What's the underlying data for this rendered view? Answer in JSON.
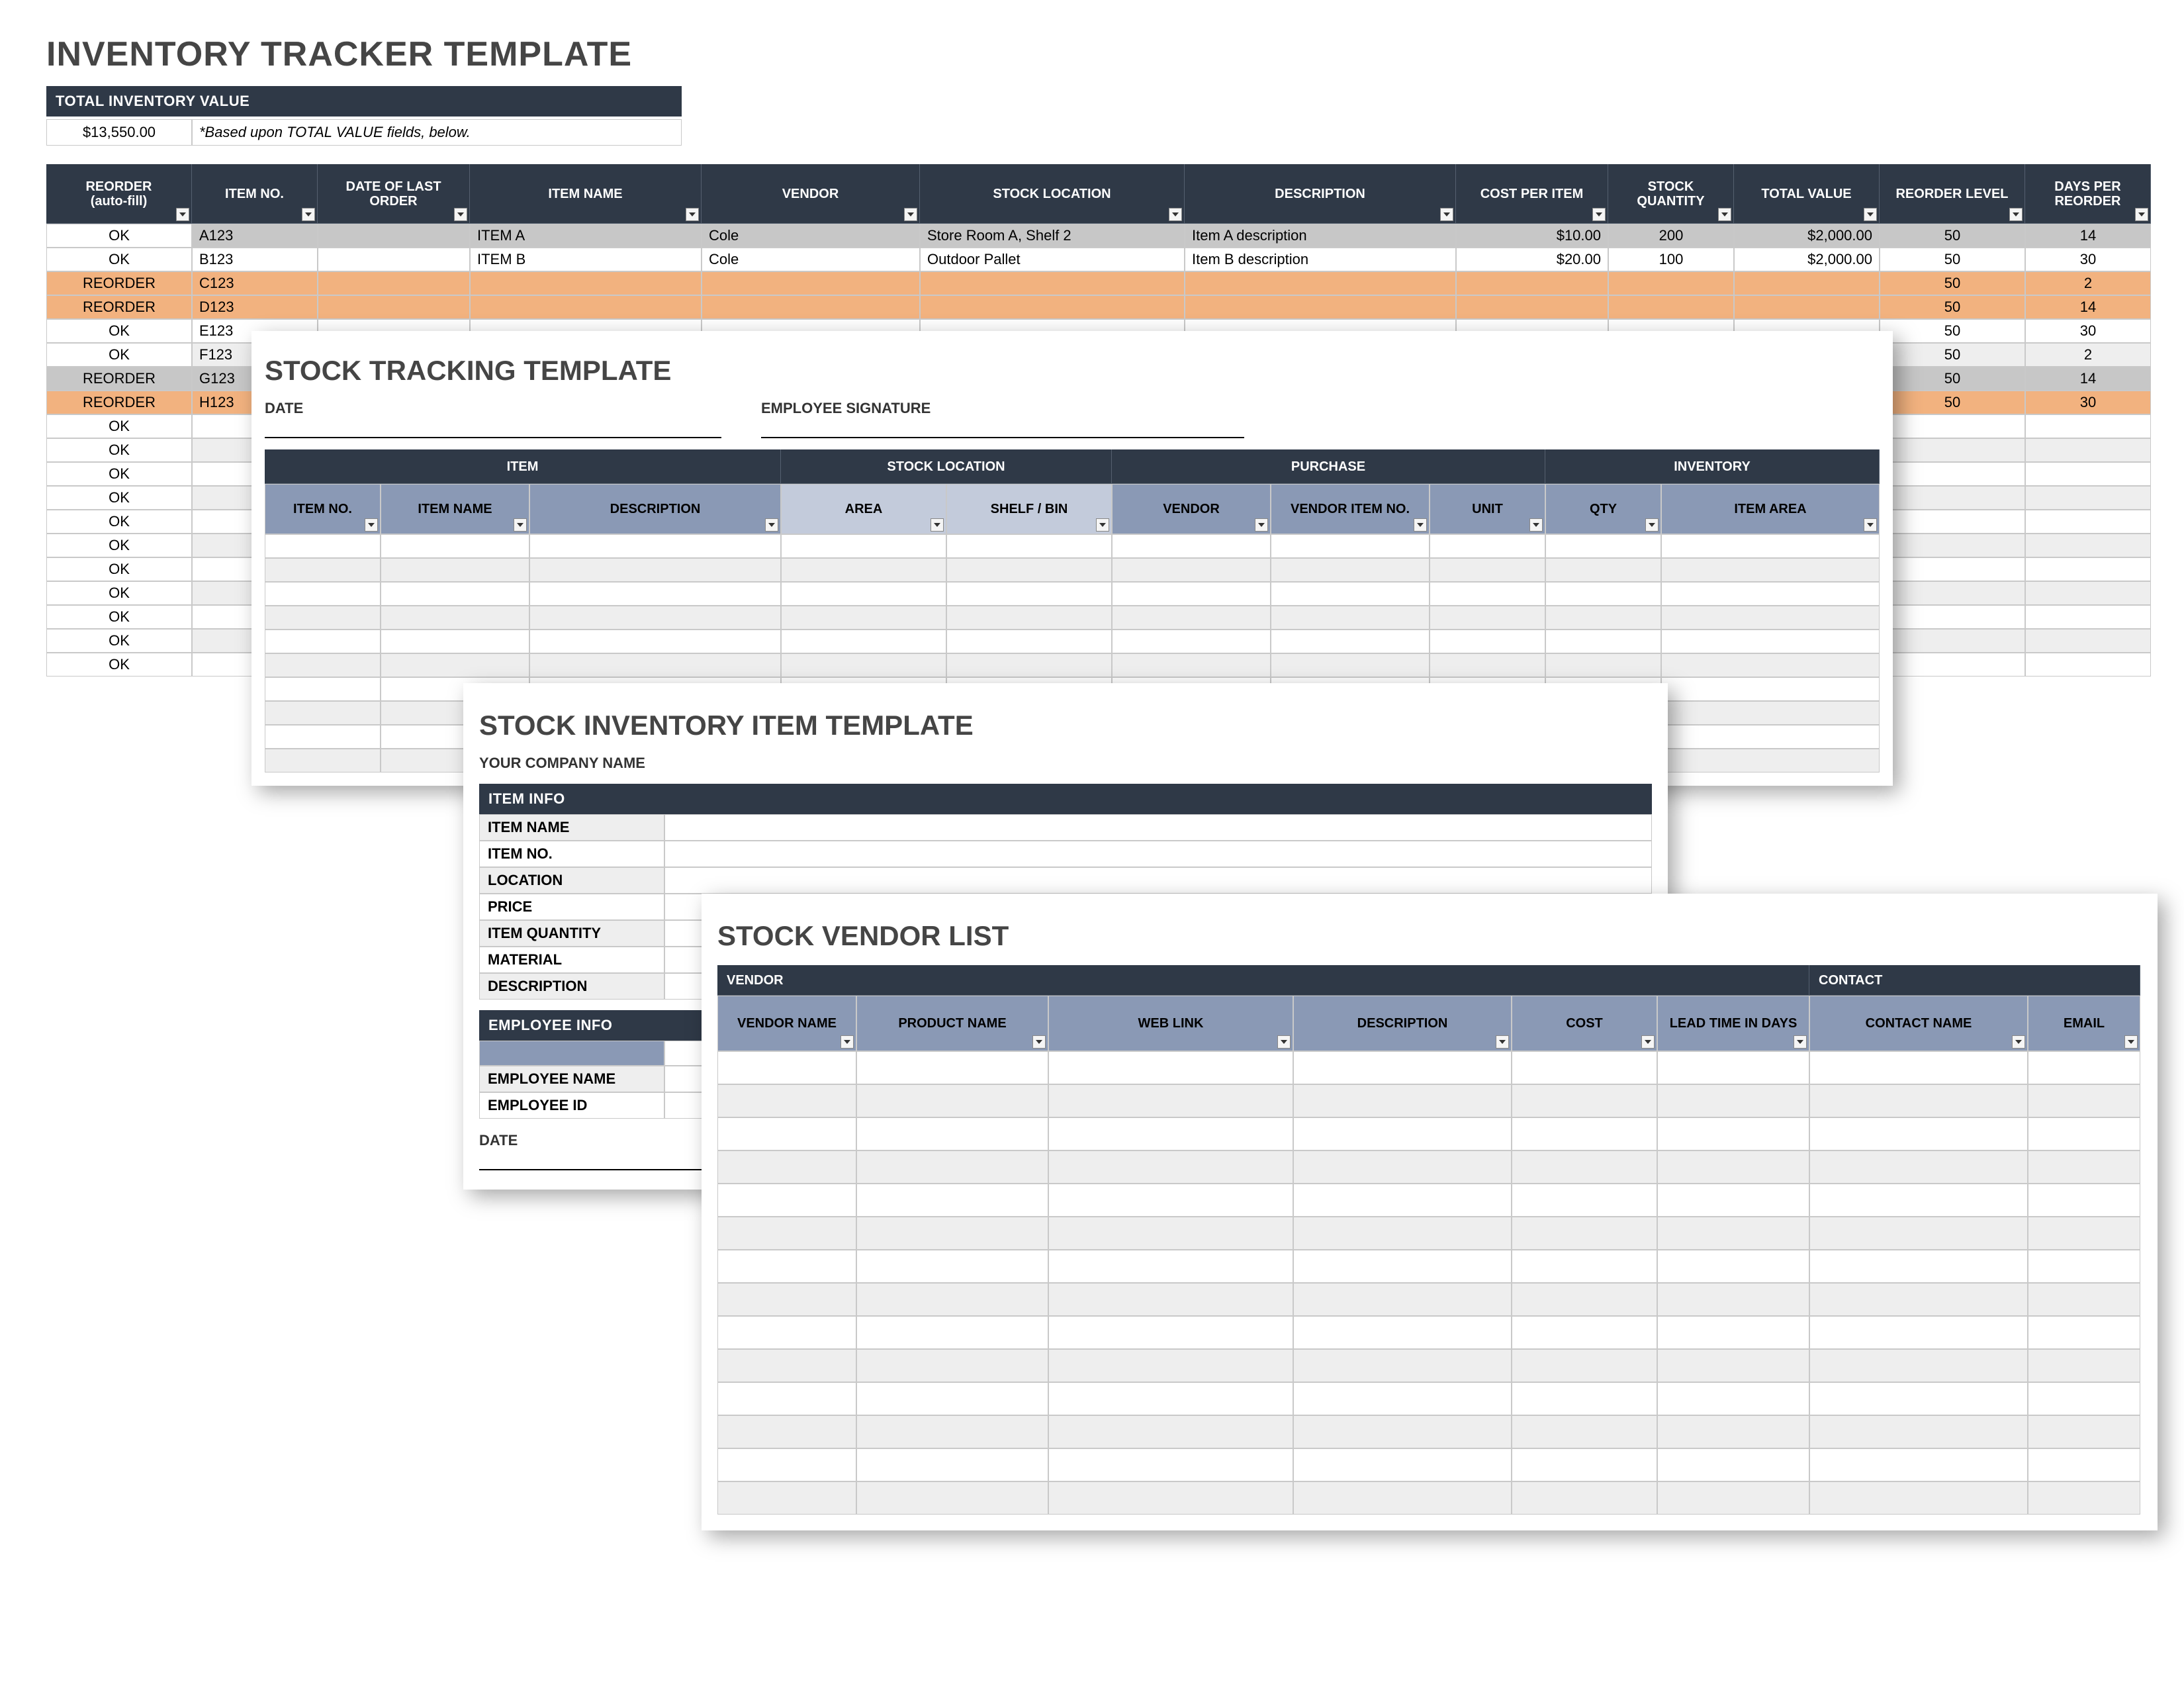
{
  "tracker": {
    "title": "INVENTORY TRACKER TEMPLATE",
    "total_label": "TOTAL INVENTORY VALUE",
    "total_value": "$13,550.00",
    "total_note": "*Based upon TOTAL VALUE fields, below.",
    "headers": [
      "REORDER\n(auto-fill)",
      "ITEM NO.",
      "DATE OF LAST ORDER",
      "ITEM NAME",
      "VENDOR",
      "STOCK LOCATION",
      "DESCRIPTION",
      "COST PER ITEM",
      "STOCK QUANTITY",
      "TOTAL VALUE",
      "REORDER LEVEL",
      "DAYS PER REORDER"
    ],
    "rows": [
      {
        "status": "OK",
        "item": "A123",
        "date": "",
        "name": "ITEM A",
        "vendor": "Cole",
        "loc": "Store Room A, Shelf 2",
        "desc": "Item A description",
        "cost": "$10.00",
        "qty": "200",
        "total": "$2,000.00",
        "reorder": "50",
        "days": "14",
        "tone": "grey"
      },
      {
        "status": "OK",
        "item": "B123",
        "date": "",
        "name": "ITEM B",
        "vendor": "Cole",
        "loc": "Outdoor Pallet",
        "desc": "Item B description",
        "cost": "$20.00",
        "qty": "100",
        "total": "$2,000.00",
        "reorder": "50",
        "days": "30",
        "tone": "even"
      },
      {
        "status": "REORDER",
        "item": "C123",
        "date": "",
        "name": "",
        "vendor": "",
        "loc": "",
        "desc": "",
        "cost": "",
        "qty": "",
        "total": "",
        "reorder": "50",
        "days": "2",
        "tone": "orange"
      },
      {
        "status": "REORDER",
        "item": "D123",
        "date": "",
        "name": "",
        "vendor": "",
        "loc": "",
        "desc": "",
        "cost": "",
        "qty": "",
        "total": "",
        "reorder": "50",
        "days": "14",
        "tone": "orange"
      },
      {
        "status": "OK",
        "item": "E123",
        "date": "",
        "name": "",
        "vendor": "",
        "loc": "",
        "desc": "",
        "cost": "",
        "qty": "",
        "total": "",
        "reorder": "50",
        "days": "30",
        "tone": "even"
      },
      {
        "status": "OK",
        "item": "F123",
        "date": "",
        "name": "",
        "vendor": "",
        "loc": "",
        "desc": "",
        "cost": "",
        "qty": "",
        "total": "",
        "reorder": "50",
        "days": "2",
        "tone": "odd"
      },
      {
        "status": "REORDER",
        "item": "G123",
        "date": "",
        "name": "",
        "vendor": "",
        "loc": "",
        "desc": "",
        "cost": "",
        "qty": "",
        "total": "",
        "reorder": "50",
        "days": "14",
        "tone": "grey"
      },
      {
        "status": "REORDER",
        "item": "H123",
        "date": "",
        "name": "",
        "vendor": "",
        "loc": "",
        "desc": "",
        "cost": "",
        "qty": "",
        "total": "",
        "reorder": "50",
        "days": "30",
        "tone": "orange"
      },
      {
        "status": "OK",
        "item": "",
        "date": "",
        "name": "",
        "vendor": "",
        "loc": "",
        "desc": "",
        "cost": "",
        "qty": "",
        "total": "",
        "reorder": "",
        "days": "",
        "tone": "even"
      },
      {
        "status": "OK",
        "item": "",
        "date": "",
        "name": "",
        "vendor": "",
        "loc": "",
        "desc": "",
        "cost": "",
        "qty": "",
        "total": "",
        "reorder": "",
        "days": "",
        "tone": "odd"
      },
      {
        "status": "OK",
        "item": "",
        "date": "",
        "name": "",
        "vendor": "",
        "loc": "",
        "desc": "",
        "cost": "",
        "qty": "",
        "total": "",
        "reorder": "",
        "days": "",
        "tone": "even"
      },
      {
        "status": "OK",
        "item": "",
        "date": "",
        "name": "",
        "vendor": "",
        "loc": "",
        "desc": "",
        "cost": "",
        "qty": "",
        "total": "",
        "reorder": "",
        "days": "",
        "tone": "odd"
      },
      {
        "status": "OK",
        "item": "",
        "date": "",
        "name": "",
        "vendor": "",
        "loc": "",
        "desc": "",
        "cost": "",
        "qty": "",
        "total": "",
        "reorder": "",
        "days": "",
        "tone": "even"
      },
      {
        "status": "OK",
        "item": "",
        "date": "",
        "name": "",
        "vendor": "",
        "loc": "",
        "desc": "",
        "cost": "",
        "qty": "",
        "total": "",
        "reorder": "",
        "days": "",
        "tone": "odd"
      },
      {
        "status": "OK",
        "item": "",
        "date": "",
        "name": "",
        "vendor": "",
        "loc": "",
        "desc": "",
        "cost": "",
        "qty": "",
        "total": "",
        "reorder": "",
        "days": "",
        "tone": "even"
      },
      {
        "status": "OK",
        "item": "",
        "date": "",
        "name": "",
        "vendor": "",
        "loc": "",
        "desc": "",
        "cost": "",
        "qty": "",
        "total": "",
        "reorder": "",
        "days": "",
        "tone": "odd"
      },
      {
        "status": "OK",
        "item": "",
        "date": "",
        "name": "",
        "vendor": "",
        "loc": "",
        "desc": "",
        "cost": "",
        "qty": "",
        "total": "",
        "reorder": "",
        "days": "",
        "tone": "even"
      },
      {
        "status": "OK",
        "item": "",
        "date": "",
        "name": "",
        "vendor": "",
        "loc": "",
        "desc": "",
        "cost": "",
        "qty": "",
        "total": "",
        "reorder": "",
        "days": "",
        "tone": "odd"
      },
      {
        "status": "OK",
        "item": "",
        "date": "",
        "name": "",
        "vendor": "",
        "loc": "",
        "desc": "",
        "cost": "",
        "qty": "",
        "total": "",
        "reorder": "",
        "days": "",
        "tone": "even"
      }
    ]
  },
  "tracking": {
    "title": "STOCK TRACKING TEMPLATE",
    "label_date": "DATE",
    "label_sig": "EMPLOYEE SIGNATURE",
    "groups": [
      "ITEM",
      "STOCK LOCATION",
      "PURCHASE",
      "INVENTORY"
    ],
    "headers": [
      "ITEM NO.",
      "ITEM NAME",
      "DESCRIPTION",
      "AREA",
      "SHELF / BIN",
      "VENDOR",
      "VENDOR ITEM NO.",
      "UNIT",
      "QTY",
      "ITEM AREA"
    ],
    "empty_rows": 10
  },
  "stockitem": {
    "title": "STOCK INVENTORY ITEM TEMPLATE",
    "company": "YOUR COMPANY NAME",
    "section_item": "ITEM INFO",
    "fields_item": [
      "ITEM NAME",
      "ITEM NO.",
      "LOCATION",
      "PRICE",
      "ITEM QUANTITY",
      "MATERIAL",
      "DESCRIPTION"
    ],
    "section_emp": "EMPLOYEE INFO",
    "fields_emp_blank": "",
    "fields_emp": [
      "EMPLOYEE NAME",
      "EMPLOYEE ID"
    ],
    "label_date": "DATE"
  },
  "vendor": {
    "title": "STOCK VENDOR LIST",
    "groups": [
      "VENDOR",
      "CONTACT"
    ],
    "headers": [
      "VENDOR NAME",
      "PRODUCT NAME",
      "WEB LINK",
      "DESCRIPTION",
      "COST",
      "LEAD TIME IN DAYS",
      "CONTACT NAME",
      "EMAIL"
    ],
    "empty_rows": 14
  }
}
